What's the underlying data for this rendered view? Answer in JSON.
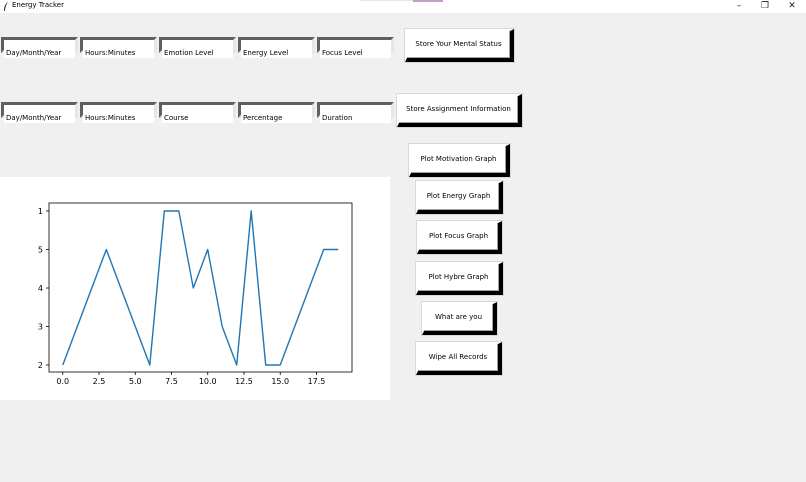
{
  "window": {
    "title": "Energy Tracker",
    "minimize_icon": "minimize-icon",
    "maximize_icon": "restore-icon",
    "close_icon": "close-icon"
  },
  "mental_row": {
    "fields": [
      "Day/Month/Year",
      "Hours:Minutes",
      "Emotion Level",
      "Energy Level",
      "Focus Level"
    ],
    "button": "Store Your Mental Status"
  },
  "assignment_row": {
    "fields": [
      "Day/Month/Year",
      "Hours:Minutes",
      "Course",
      "Percentage",
      "Duration"
    ],
    "button": "Store Assignment Information"
  },
  "buttons": {
    "motivation": "Plot Motivation Graph",
    "energy": "Plot Energy Graph",
    "focus": "Plot Focus Graph",
    "hybre": "Plot Hybre Graph",
    "what": "What are you",
    "wipe": "Wipe All Records"
  },
  "chart_data": {
    "type": "line",
    "x": [
      0,
      1,
      2,
      3,
      4,
      5,
      6,
      7,
      8,
      9,
      10,
      11,
      12,
      13,
      14,
      15,
      16,
      17,
      18,
      19
    ],
    "y": [
      2,
      3,
      4,
      5,
      4,
      3,
      2,
      1,
      1,
      4,
      5,
      3,
      2,
      1,
      2,
      2,
      3,
      4,
      5,
      5
    ],
    "x_ticks": [
      "0.0",
      "2.5",
      "5.0",
      "7.5",
      "10.0",
      "12.5",
      "15.0",
      "17.5"
    ],
    "x_tick_values": [
      0,
      2.5,
      5,
      7.5,
      10,
      12.5,
      15,
      17.5
    ],
    "y_ticks": [
      "1",
      "5",
      "4",
      "3",
      "2"
    ],
    "y_tick_values": [
      1,
      5,
      4,
      3,
      2
    ],
    "xlim": [
      -0.95,
      19.95
    ],
    "y_order": [
      1,
      5,
      4,
      3,
      2
    ],
    "line_color": "#1f77b4",
    "grid": false
  }
}
